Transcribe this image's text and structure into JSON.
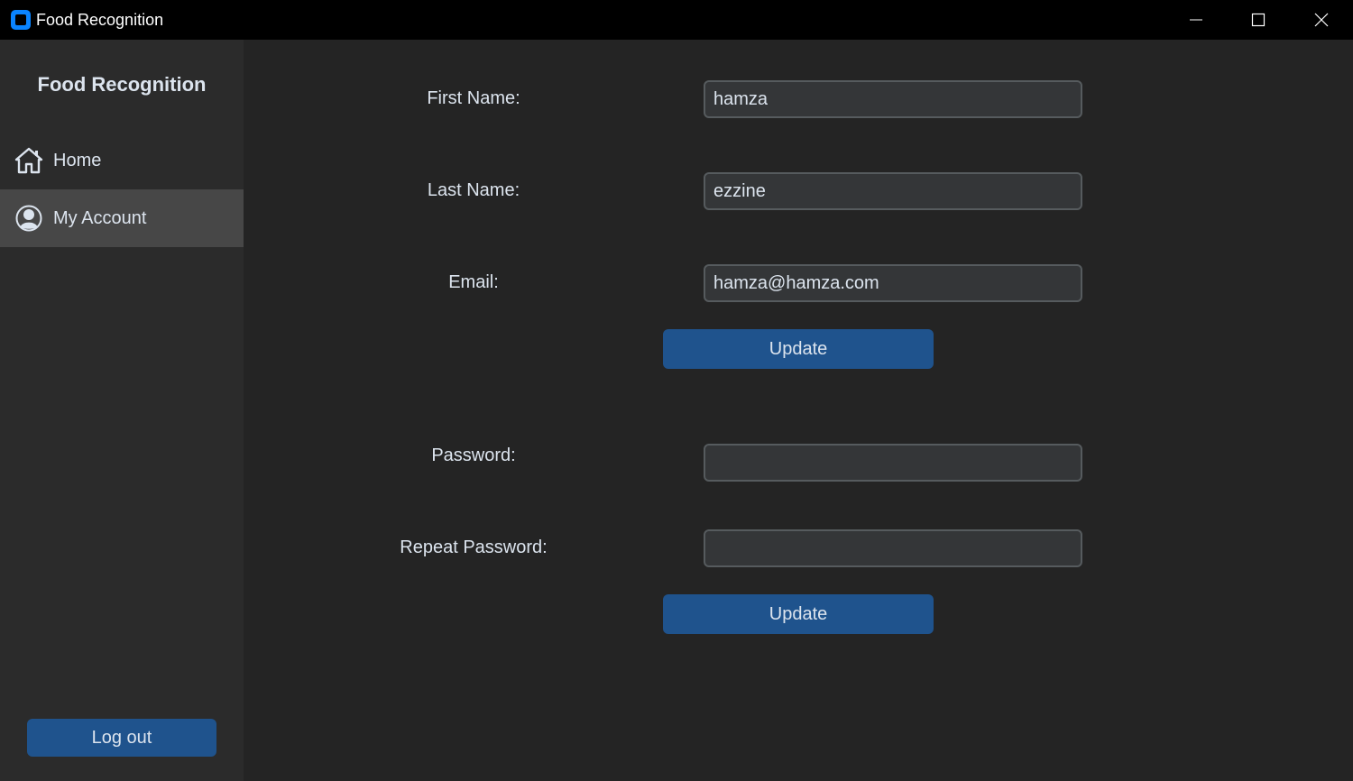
{
  "window": {
    "title": "Food Recognition",
    "icon": "app-icon",
    "controls": [
      "minimize-icon",
      "maximize-icon",
      "close-icon"
    ]
  },
  "sidebar": {
    "title": "Food Recognition",
    "items": [
      {
        "label": "Home",
        "icon": "home-icon",
        "selected": false
      },
      {
        "label": "My Account",
        "icon": "user-icon",
        "selected": true
      }
    ],
    "logout_label": "Log out"
  },
  "profile_form": {
    "first_name_label": "First Name:",
    "first_name_value": "hamza",
    "last_name_label": "Last Name:",
    "last_name_value": "ezzine",
    "email_label": "Email:",
    "email_value": "hamza@hamza.com",
    "update_label": "Update"
  },
  "password_form": {
    "password_label": "Password:",
    "password_value": "",
    "repeat_label": "Repeat Password:",
    "repeat_value": "",
    "update_label": "Update"
  },
  "colors": {
    "titlebar_bg": "#000000",
    "content_bg": "#242424",
    "sidebar_bg": "#2b2b2b",
    "selected_item_bg": "#474747",
    "button_bg": "#1f538d",
    "input_bg": "#343638",
    "input_border": "#565b5e",
    "text": "#dce4ee",
    "app_icon": "#0a84ff"
  }
}
